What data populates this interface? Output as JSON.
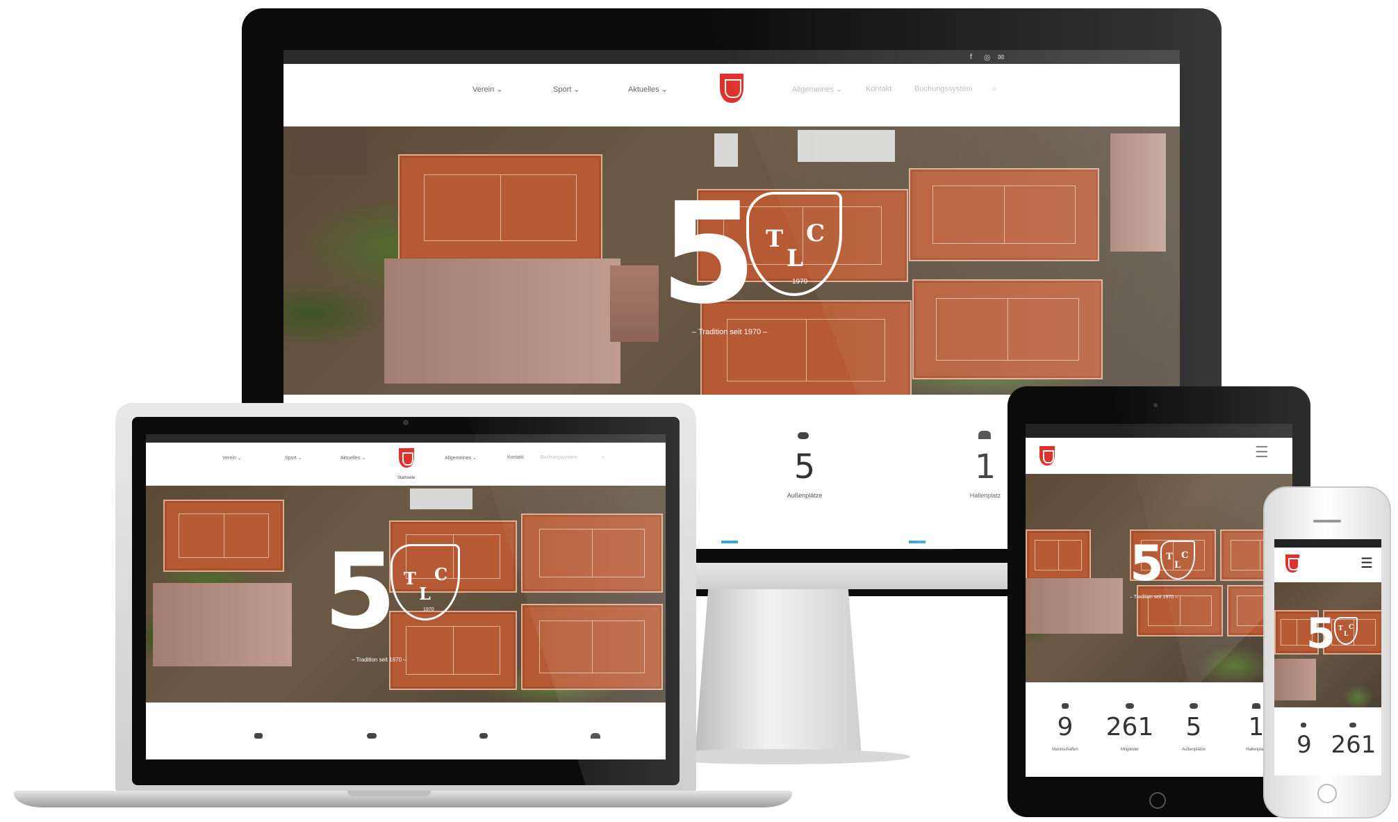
{
  "site": {
    "nav": {
      "items": [
        "Verein",
        "Sport",
        "Aktuelles"
      ],
      "items_right": [
        "Allgemeines",
        "Kontakt",
        "Buchungssystem"
      ],
      "sublabel": "Startseite"
    },
    "hero": {
      "big_number": "5",
      "shield_letters": [
        "T",
        "C",
        "L"
      ],
      "shield_year": "1970",
      "tagline": "– Tradition seit 1970 –"
    },
    "stats": [
      {
        "value": "9",
        "label": "Mannschaften",
        "icon": "chart-icon"
      },
      {
        "value": "261",
        "label": "Mitglieder",
        "icon": "members-icon"
      },
      {
        "value": "5",
        "label": "Außenplätze",
        "icon": "cloud-icon"
      },
      {
        "value": "1",
        "label": "Hallenplatz",
        "icon": "hall-icon"
      }
    ],
    "colors": {
      "brand_red": "#e0322c",
      "court_clay": "#b55a34",
      "device_black": "#0b0b0b",
      "device_silver": "#d9d9d9"
    }
  }
}
